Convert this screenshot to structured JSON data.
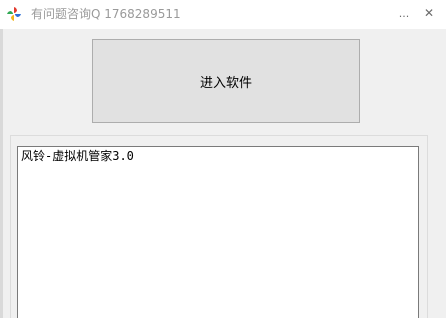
{
  "window": {
    "title": "有问题咨询Q 1768289511",
    "app_icon": "pinwheel-logo-icon",
    "minimize_label": "...",
    "close_label": "✕"
  },
  "main": {
    "enter_button_label": "进入软件"
  },
  "log": {
    "text": "风铃-虚拟机管家3.0"
  }
}
